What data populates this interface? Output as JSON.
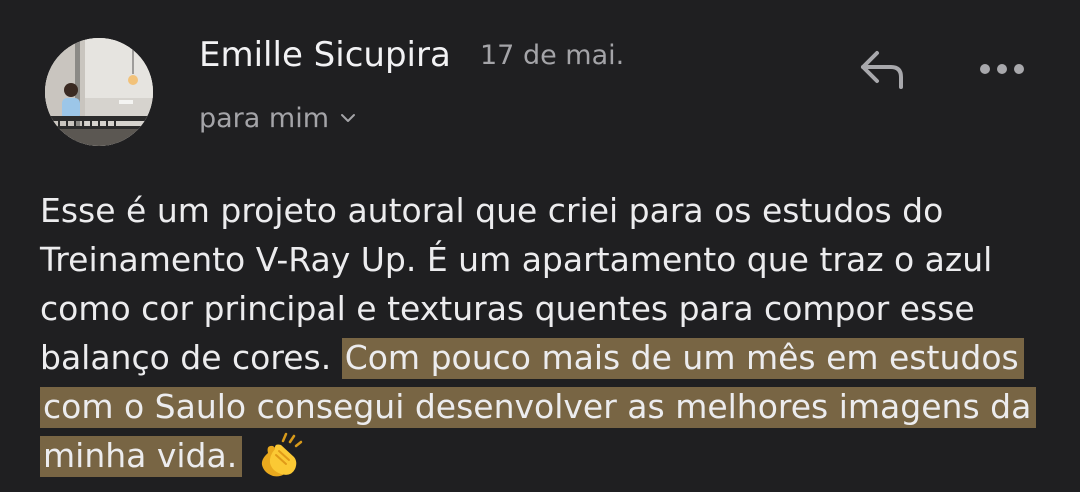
{
  "email": {
    "sender_name": "Emille Sicupira",
    "date": "17 de mai.",
    "recipient_label": "para mim",
    "avatar": {
      "icon": "sender-avatar-photo"
    },
    "actions": {
      "reply_icon": "reply-arrow-icon",
      "more_icon": "more-horizontal-dots-icon"
    },
    "body": {
      "text": "Esse é um projeto autoral que criei para os estudos do Treinamento V-Ray Up. É um apartamento que traz o azul como cor principal e texturas quentes para compor esse balanço de cores.",
      "highlighted_text": "Com pouco mais de um mês em estudos com o Saulo consegui desenvolver as melhores imagens da minha vida.",
      "emoji": "clapping-hands-emoji"
    }
  },
  "colors": {
    "background": "#1f1f21",
    "highlight": "#786544",
    "primary_text": "#ececee",
    "secondary_text": "#a4a4a8"
  }
}
